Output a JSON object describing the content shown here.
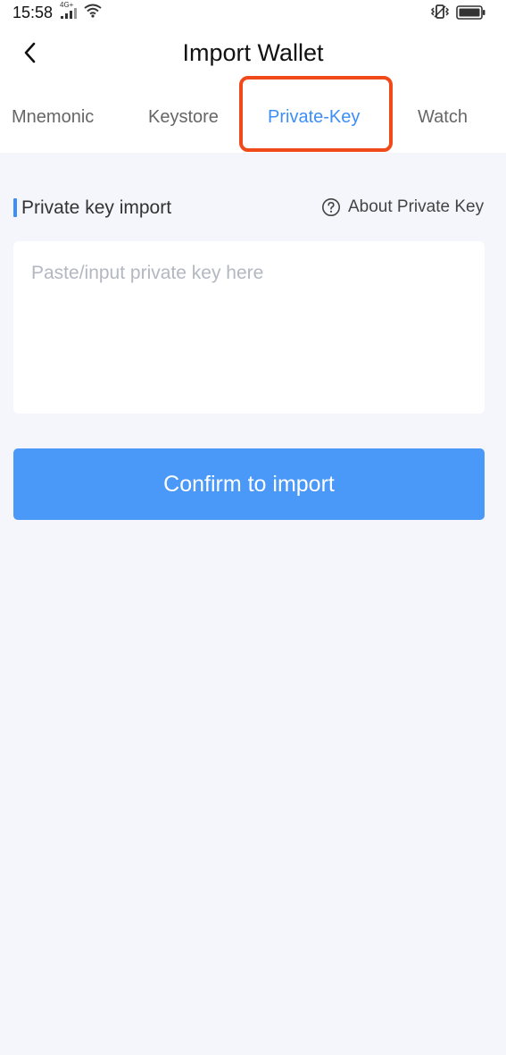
{
  "status_bar": {
    "time": "15:58",
    "network": "4G+"
  },
  "header": {
    "title": "Import Wallet",
    "back_icon": "chevron-left-icon"
  },
  "tabs": [
    {
      "label": "Mnemonic",
      "active": false
    },
    {
      "label": "Keystore",
      "active": false
    },
    {
      "label": "Private-Key",
      "active": true
    },
    {
      "label": "Watch",
      "active": false
    }
  ],
  "section": {
    "title": "Private key import",
    "about_label": "About Private Key",
    "about_icon": "question-circle-icon"
  },
  "input": {
    "placeholder": "Paste/input private key here",
    "value": ""
  },
  "confirm_button": {
    "label": "Confirm to import"
  },
  "colors": {
    "accent": "#3d8ef7",
    "button": "#4a98f7",
    "highlight": "#f04a1a",
    "background": "#f5f6fb"
  }
}
